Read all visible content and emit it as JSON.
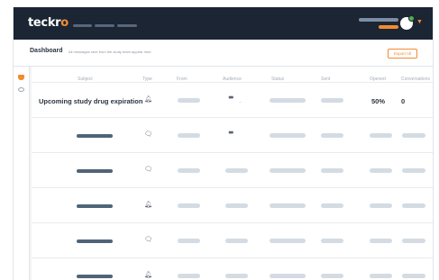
{
  "app": {
    "logo_text": "teckr",
    "logo_accent": "o",
    "nav_items": [
      {
        "name": "nav-item-1"
      },
      {
        "name": "nav-item-2"
      },
      {
        "name": "nav-item-3"
      }
    ],
    "colors": {
      "topbar": "#1b2533",
      "accent": "#f28b30",
      "status_online": "#4caf50",
      "skeleton": "#d4dbe3",
      "skeleton_dark": "#4f6478"
    }
  },
  "header": {
    "title": "Dashboard",
    "description": "All messages sent from the study team appear here",
    "export_label": "Export All"
  },
  "sidebar": {
    "icons": [
      "alert-icon",
      "eye-icon"
    ]
  },
  "table": {
    "columns": [
      "Subject",
      "Type",
      "From",
      "Audience",
      "Status",
      "Sent",
      "Opened",
      "Conversations"
    ],
    "rows": [
      {
        "subject": "Upcoming study drug expiration",
        "type_icon": "bell-icon",
        "audience_icon": "group-icon",
        "audience_count": "—",
        "opened": "50%",
        "conversations": "0"
      },
      {
        "subject": "",
        "type_icon": "chat-icon",
        "audience_icon": "group-icon",
        "audience_count": "",
        "opened": "",
        "conversations": ""
      },
      {
        "subject": "",
        "type_icon": "chat-icon",
        "audience_icon": "",
        "audience_count": "",
        "opened": "",
        "conversations": ""
      },
      {
        "subject": "",
        "type_icon": "bell-icon",
        "audience_icon": "",
        "audience_count": "",
        "opened": "",
        "conversations": ""
      },
      {
        "subject": "",
        "type_icon": "chat-icon",
        "audience_icon": "",
        "audience_count": "",
        "opened": "",
        "conversations": ""
      },
      {
        "subject": "",
        "type_icon": "bell-icon",
        "audience_icon": "",
        "audience_count": "",
        "opened": "",
        "conversations": ""
      }
    ]
  }
}
